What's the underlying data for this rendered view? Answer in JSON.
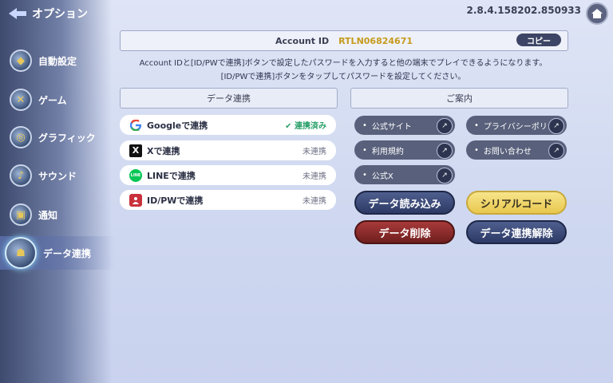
{
  "header": {
    "title": "オプション",
    "version": "2.8.4.158202.850933"
  },
  "sidebar": {
    "items": [
      {
        "label": "自動設定"
      },
      {
        "label": "ゲーム"
      },
      {
        "label": "グラフィック"
      },
      {
        "label": "サウンド"
      },
      {
        "label": "通知"
      },
      {
        "label": "データ連携"
      }
    ]
  },
  "account": {
    "label": "Account ID",
    "id": "RTLN06824671",
    "copy_label": "コピー",
    "info_line1": "Account IDと[ID/PWで連携]ボタンで設定したパスワードを入力すると他の端末でプレイできるようになります。",
    "info_line2": "[ID/PWで連携]ボタンをタップしてパスワードを設定してください。"
  },
  "data_link": {
    "header": "データ連携",
    "rows": [
      {
        "icon": "google-icon",
        "label": "Googleで連携",
        "status": "連携済み",
        "linked": true
      },
      {
        "icon": "x-icon",
        "label": "Xで連携",
        "status": "未連携",
        "linked": false
      },
      {
        "icon": "line-icon",
        "label": "LINEで連携",
        "status": "未連携",
        "linked": false
      },
      {
        "icon": "idpw-icon",
        "label": "ID/PWで連携",
        "status": "未連携",
        "linked": false
      }
    ]
  },
  "guide": {
    "header": "ご案内",
    "links": [
      {
        "label": "公式サイト"
      },
      {
        "label": "プライバシーポリシー"
      },
      {
        "label": "利用規約"
      },
      {
        "label": "お問い合わせ"
      },
      {
        "label": "公式X"
      }
    ],
    "actions": {
      "load": "データ読み込み",
      "serial": "シリアルコード",
      "delete": "データ削除",
      "unlink": "データ連携解除"
    }
  },
  "colors": {
    "accent_gold": "#e8c74e",
    "navy": "#2d3a66",
    "danger": "#6f1e1e",
    "linked_green": "#2aa06a"
  }
}
